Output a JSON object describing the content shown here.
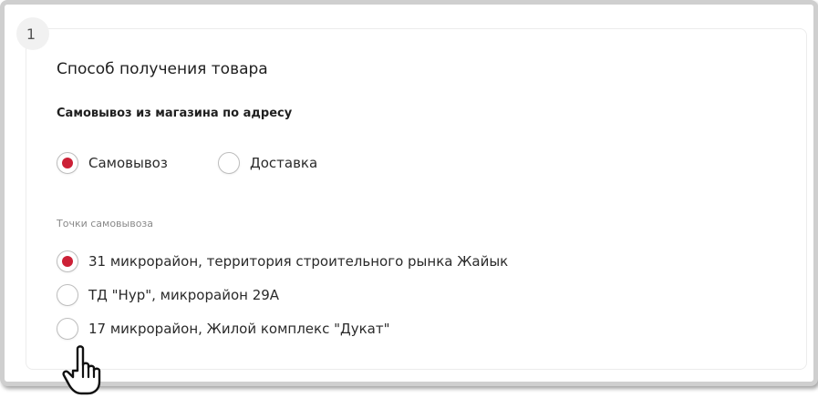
{
  "step": {
    "number": "1"
  },
  "section": {
    "title": "Способ получения товара",
    "subtitle": "Самовывоз из магазина по адресу"
  },
  "delivery_method": {
    "options": [
      {
        "label": "Самовывоз",
        "selected": true
      },
      {
        "label": "Доставка",
        "selected": false
      }
    ]
  },
  "pickup_points": {
    "label": "Точки самовывоза",
    "options": [
      {
        "label": "31 микрорайон, территория строительного рынка Жайык",
        "selected": true
      },
      {
        "label": "ТД \"Нур\", микрорайон 29А",
        "selected": false
      },
      {
        "label": "17 микрорайон, Жилой комплекс \"Дукат\"",
        "selected": false
      }
    ]
  },
  "colors": {
    "accent": "#cc2036",
    "frame_border": "#cfcfcf"
  },
  "icons": {
    "cursor": "hand-pointer-icon"
  }
}
